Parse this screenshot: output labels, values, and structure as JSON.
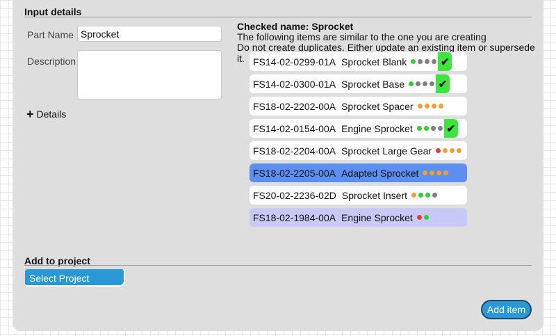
{
  "input_details": {
    "title": "Input details",
    "part_name_label": "Part Name",
    "part_name_value": "Sprocket",
    "description_label": "Description",
    "description_value": "",
    "details_label": "Details"
  },
  "checked": {
    "title": "Checked name: Sprocket",
    "line1": "The following items are similar to the one you are creating",
    "line2": "Do not create duplicates. Either update an existing item or supersede it."
  },
  "colors": {
    "green": "#2fd12f",
    "grey": "#7f7f7f",
    "orange": "#f0a030",
    "red": "#e53b3b",
    "selected": "#5c8ff0",
    "lavender": "#c9c9f8",
    "check": "#3de63d",
    "accent": "#2a98d6"
  },
  "items": [
    {
      "code": "FS14-02-0299-01A",
      "name": "Sprocket Blank",
      "dots": [
        "green",
        "grey",
        "grey",
        "grey"
      ],
      "checked": true,
      "state": "normal"
    },
    {
      "code": "FS14-02-0300-01A",
      "name": "Sprocket Base",
      "dots": [
        "green",
        "grey",
        "grey",
        "grey"
      ],
      "checked": true,
      "state": "normal"
    },
    {
      "code": "FS18-02-2202-00A",
      "name": "Sprocket Spacer",
      "dots": [
        "orange",
        "orange",
        "orange",
        "orange"
      ],
      "checked": false,
      "state": "normal"
    },
    {
      "code": "FS14-02-0154-00A",
      "name": "Engine Sprocket",
      "dots": [
        "green",
        "green",
        "grey",
        "grey"
      ],
      "checked": true,
      "state": "normal"
    },
    {
      "code": "FS18-02-2204-00A",
      "name": "Sprocket Large Gear",
      "dots": [
        "red",
        "orange",
        "orange",
        "orange"
      ],
      "checked": false,
      "state": "normal"
    },
    {
      "code": "FS18-02-2205-00A",
      "name": "Adapted Sprocket",
      "dots": [
        "orange",
        "orange",
        "orange",
        "orange"
      ],
      "checked": false,
      "state": "selected"
    },
    {
      "code": "FS20-02-2236-02D",
      "name": "Sprocket Insert",
      "dots": [
        "orange",
        "green",
        "green",
        "grey"
      ],
      "checked": false,
      "state": "normal"
    },
    {
      "code": "FS18-02-1984-00A",
      "name": "Engine Sprocket",
      "dots": [
        "red",
        "green"
      ],
      "checked": false,
      "state": "lavender"
    }
  ],
  "check_icon": "check-icon",
  "project": {
    "title": "Add to project",
    "select_label": "Select Project"
  },
  "add_item_label": "Add item"
}
